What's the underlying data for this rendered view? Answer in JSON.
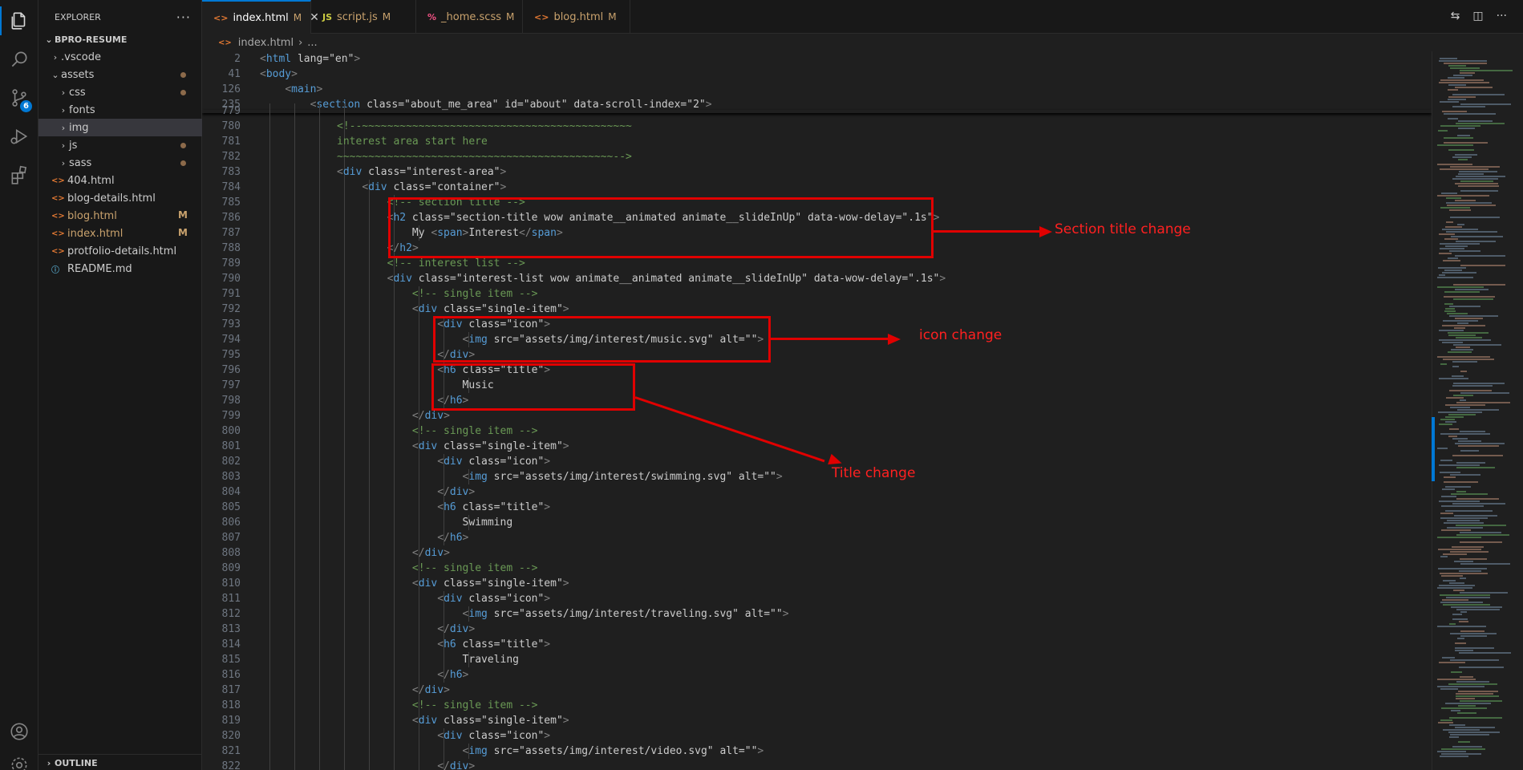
{
  "explorer": {
    "title": "EXPLORER",
    "more": "···",
    "project": "BPRO-RESUME",
    "items": [
      {
        "label": ".vscode",
        "kind": "folder"
      },
      {
        "label": "assets",
        "kind": "folder-open"
      },
      {
        "label": "css",
        "kind": "folder"
      },
      {
        "label": "fonts",
        "kind": "folder"
      },
      {
        "label": "img",
        "kind": "folder"
      },
      {
        "label": "js",
        "kind": "folder"
      },
      {
        "label": "sass",
        "kind": "folder"
      },
      {
        "label": "404.html",
        "kind": "html"
      },
      {
        "label": "blog-details.html",
        "kind": "html"
      },
      {
        "label": "blog.html",
        "kind": "html",
        "status": "M"
      },
      {
        "label": "index.html",
        "kind": "html",
        "status": "M"
      },
      {
        "label": "protfolio-details.html",
        "kind": "html"
      },
      {
        "label": "README.md",
        "kind": "md"
      }
    ],
    "outline": "OUTLINE",
    "source_control_badge": "6"
  },
  "tabs": [
    {
      "label": "index.html",
      "icon": "<>",
      "status": "M",
      "close": "✕"
    },
    {
      "label": "script.js",
      "icon": "JS",
      "status": "M"
    },
    {
      "label": "_home.scss",
      "icon": "%",
      "status": "M"
    },
    {
      "label": "blog.html",
      "icon": "<>",
      "status": "M"
    }
  ],
  "breadcrumb": {
    "file": "index.html",
    "sep": "›",
    "rest": "..."
  },
  "sticky_lines": [
    {
      "n": "2",
      "code": "<html lang=\"en\">"
    },
    {
      "n": "41",
      "code": "<body>"
    },
    {
      "n": "126",
      "code": "    <main>"
    },
    {
      "n": "235",
      "code": "        <section class=\"about_me_area\" id=\"about\" data-scroll-index=\"2\">"
    }
  ],
  "code_lines": [
    {
      "n": "779",
      "code": ""
    },
    {
      "n": "780",
      "code": "<!--~~~~~~~~~~~~~~~~~~~~~~~~~~~~~~~~~~~~~~~~~~~"
    },
    {
      "n": "781",
      "code": "interest area start here"
    },
    {
      "n": "782",
      "code": "~~~~~~~~~~~~~~~~~~~~~~~~~~~~~~~~~~~~~~~~~~~~-->"
    },
    {
      "n": "783",
      "code": "<div class=\"interest-area\">"
    },
    {
      "n": "784",
      "code": "    <div class=\"container\">"
    },
    {
      "n": "785",
      "code": "        <!-- section title -->"
    },
    {
      "n": "786",
      "code": "        <h2 class=\"section-title wow animate__animated animate__slideInUp\" data-wow-delay=\".1s\">"
    },
    {
      "n": "787",
      "code": "            My <span>Interest</span>"
    },
    {
      "n": "788",
      "code": "        </h2>"
    },
    {
      "n": "789",
      "code": "        <!-- interest list -->"
    },
    {
      "n": "790",
      "code": "        <div class=\"interest-list wow animate__animated animate__slideInUp\" data-wow-delay=\".1s\">"
    },
    {
      "n": "791",
      "code": "            <!-- single item -->"
    },
    {
      "n": "792",
      "code": "            <div class=\"single-item\">"
    },
    {
      "n": "793",
      "code": "                <div class=\"icon\">"
    },
    {
      "n": "794",
      "code": "                    <img src=\"assets/img/interest/music.svg\" alt=\"\">"
    },
    {
      "n": "795",
      "code": "                </div>"
    },
    {
      "n": "796",
      "code": "                <h6 class=\"title\">"
    },
    {
      "n": "797",
      "code": "                    Music"
    },
    {
      "n": "798",
      "code": "                </h6>"
    },
    {
      "n": "799",
      "code": "            </div>"
    },
    {
      "n": "800",
      "code": "            <!-- single item -->"
    },
    {
      "n": "801",
      "code": "            <div class=\"single-item\">"
    },
    {
      "n": "802",
      "code": "                <div class=\"icon\">"
    },
    {
      "n": "803",
      "code": "                    <img src=\"assets/img/interest/swimming.svg\" alt=\"\">"
    },
    {
      "n": "804",
      "code": "                </div>"
    },
    {
      "n": "805",
      "code": "                <h6 class=\"title\">"
    },
    {
      "n": "806",
      "code": "                    Swimming"
    },
    {
      "n": "807",
      "code": "                </h6>"
    },
    {
      "n": "808",
      "code": "            </div>"
    },
    {
      "n": "809",
      "code": "            <!-- single item -->"
    },
    {
      "n": "810",
      "code": "            <div class=\"single-item\">"
    },
    {
      "n": "811",
      "code": "                <div class=\"icon\">"
    },
    {
      "n": "812",
      "code": "                    <img src=\"assets/img/interest/traveling.svg\" alt=\"\">"
    },
    {
      "n": "813",
      "code": "                </div>"
    },
    {
      "n": "814",
      "code": "                <h6 class=\"title\">"
    },
    {
      "n": "815",
      "code": "                    Traveling"
    },
    {
      "n": "816",
      "code": "                </h6>"
    },
    {
      "n": "817",
      "code": "            </div>"
    },
    {
      "n": "818",
      "code": "            <!-- single item -->"
    },
    {
      "n": "819",
      "code": "            <div class=\"single-item\">"
    },
    {
      "n": "820",
      "code": "                <div class=\"icon\">"
    },
    {
      "n": "821",
      "code": "                    <img src=\"assets/img/interest/video.svg\" alt=\"\">"
    },
    {
      "n": "822",
      "code": "                </div>"
    }
  ],
  "annotations": {
    "section_title": "Section title change",
    "icon": "icon change",
    "title": "Title change"
  },
  "colors": {
    "accent": "#0078d4",
    "annotation": "#e00000",
    "modified": "#c9a26d"
  }
}
